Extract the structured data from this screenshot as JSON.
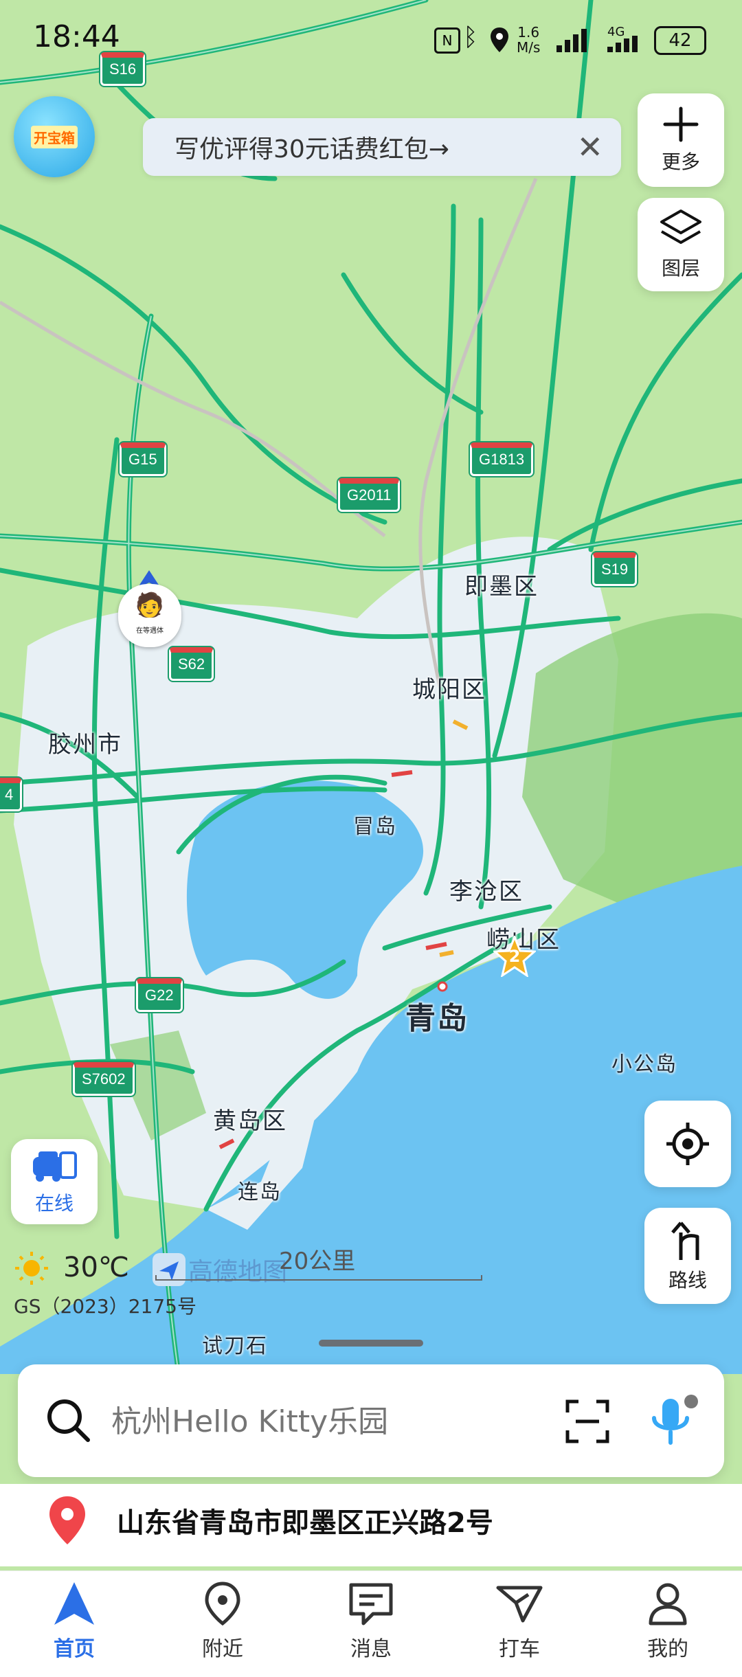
{
  "status_bar": {
    "time": "18:44",
    "net_speed_value": "1.6",
    "net_speed_unit": "M/s",
    "network": "4G",
    "battery": "42"
  },
  "top": {
    "treasure_badge": "开宝箱",
    "banner_text": "写优评得30元话费红包→",
    "more_label": "更多",
    "layers_label": "图层"
  },
  "map": {
    "labels": {
      "jimo": "即墨区",
      "chengyang": "城阳区",
      "jiaozhou": "胶州市",
      "maodao": "冒岛",
      "licang": "李沧区",
      "laoshan": "崂山区",
      "qingdao": "青岛",
      "xiaogongdao": "小公岛",
      "huangdao": "黄岛区",
      "liandao": "连岛",
      "shidaoshi": "试刀石"
    },
    "shields": {
      "s16": "S16",
      "g15": "G15",
      "g2011": "G2011",
      "g1813": "G1813",
      "s19": "S19",
      "s62": "S62",
      "g22": "G22",
      "s7602": "S7602",
      "edge": "4"
    },
    "user_avatar_caption": "在等遇体",
    "poi_star_count": "2",
    "weather": {
      "temp": "30℃",
      "icon": "sun-icon"
    },
    "brand": "高德地图",
    "scale": "20公里",
    "license": "GS（2023）2175号"
  },
  "right_controls": {
    "online_label": "在线",
    "route_label": "路线"
  },
  "search": {
    "placeholder": "杭州Hello Kitty乐园"
  },
  "address": "山东省青岛市即墨区正兴路2号",
  "tabs": [
    {
      "label": "首页",
      "icon": "navigation-arrow-icon"
    },
    {
      "label": "附近",
      "icon": "location-pin-icon"
    },
    {
      "label": "消息",
      "icon": "message-icon"
    },
    {
      "label": "打车",
      "icon": "taxi-flag-icon"
    },
    {
      "label": "我的",
      "icon": "person-icon"
    }
  ],
  "colors": {
    "accent": "#2b6fe6",
    "land": "#bfe7a6",
    "water": "#6cc3f2",
    "urban": "#e8f0f5",
    "road": "#1fb679"
  }
}
